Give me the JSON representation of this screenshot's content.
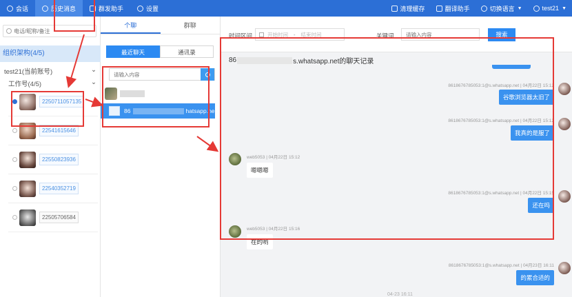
{
  "topbar": {
    "nav": [
      {
        "label": "会话",
        "icon": "chat-icon"
      },
      {
        "label": "历史消息",
        "icon": "clock-icon"
      },
      {
        "label": "群发助手",
        "icon": "broadcast-icon"
      },
      {
        "label": "设置",
        "icon": "gear-icon"
      }
    ],
    "right": [
      {
        "label": "清理缓存",
        "icon": "cache-icon"
      },
      {
        "label": "翻译助手",
        "icon": "translate-icon"
      },
      {
        "label": "切换语言",
        "icon": "globe-icon"
      }
    ],
    "user": "test21"
  },
  "left": {
    "search_placeholder": "电话/昵称/备注",
    "org_title": "组织架构(4/5)",
    "account": "test21(当前账号)",
    "work_group": "工作号(4/5)",
    "agents": [
      {
        "number": "2250711057135",
        "selected": true
      },
      {
        "number": "22541615646",
        "selected": false
      },
      {
        "number": "22550823936",
        "selected": false
      },
      {
        "number": "22540352719",
        "selected": false
      },
      {
        "number": "22505706584",
        "selected": false
      }
    ]
  },
  "middle": {
    "tabs": [
      "个聊",
      "群聊"
    ],
    "subtabs": [
      "最近聊天",
      "通讯录"
    ],
    "search_placeholder": "请输入内容",
    "conv_prefix": "86",
    "conv_suffix": "hatsapp.ne"
  },
  "right": {
    "filter_label_time": "时间区间",
    "start_placeholder": "开始时间",
    "range_sep": "-",
    "end_placeholder": "结束时间",
    "filter_label_kw": "关键词",
    "kw_placeholder": "请输入内容",
    "search_btn": "搜索",
    "title_prefix": "86",
    "title_suffix": "s.whatsapp.net的聊天记录",
    "messages": [
      {
        "meta": "8618676785053:1@s.whatsapp.net | 04月22日 15:12",
        "text": "谷歌浏览器太旧了"
      },
      {
        "meta": "8618676785053:1@s.whatsapp.net | 04月22日 15:12",
        "text": "我真的是服了"
      },
      {
        "meta": "web5053 | 04月22日 15:12",
        "text": "嗯嗯嗯"
      },
      {
        "meta": "8618676785053:1@s.whatsapp.net | 04月22日 15:15",
        "text": "还在吗"
      },
      {
        "meta": "web5053 | 04月22日 15:16",
        "text": "在的哟"
      },
      {
        "meta": "8618676785053:1@s.whatsapp.net | 04月23日 16:11",
        "text": "的累合适的"
      }
    ],
    "bottom_time": "04-23 16:11"
  }
}
